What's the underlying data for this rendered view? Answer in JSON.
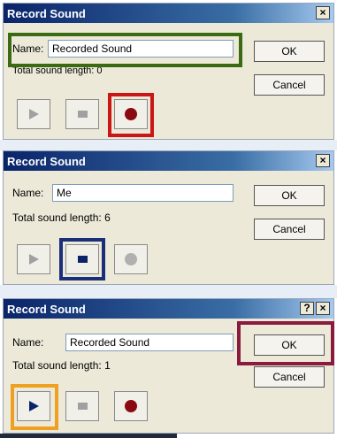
{
  "dialogs": [
    {
      "title": "Record Sound",
      "name_label": "Name:",
      "name_value": "Recorded Sound",
      "length_label": "Total sound length:",
      "length_value": "0",
      "ok_label": "OK",
      "cancel_label": "Cancel",
      "title_buttons": [
        "×"
      ],
      "highlights": {
        "name_field": "#3a6b12",
        "record": "#cc1515"
      }
    },
    {
      "title": "Record Sound",
      "name_label": "Name:",
      "name_value": "Me",
      "length_label": "Total sound length:",
      "length_value": "6",
      "ok_label": "OK",
      "cancel_label": "Cancel",
      "title_buttons": [
        "×"
      ],
      "highlights": {
        "stop": "#1a2f7a"
      }
    },
    {
      "title": "Record Sound",
      "name_label": "Name:",
      "name_value": "Recorded Sound",
      "length_label": "Total sound length:",
      "length_value": "1",
      "ok_label": "OK",
      "cancel_label": "Cancel",
      "title_buttons": [
        "?",
        "×"
      ],
      "highlights": {
        "ok": "#8b1a3f",
        "play": "#f0a020"
      }
    }
  ],
  "icons": {
    "play": "play-icon",
    "stop": "stop-icon",
    "record": "record-icon",
    "close": "close-icon",
    "help": "help-icon"
  }
}
